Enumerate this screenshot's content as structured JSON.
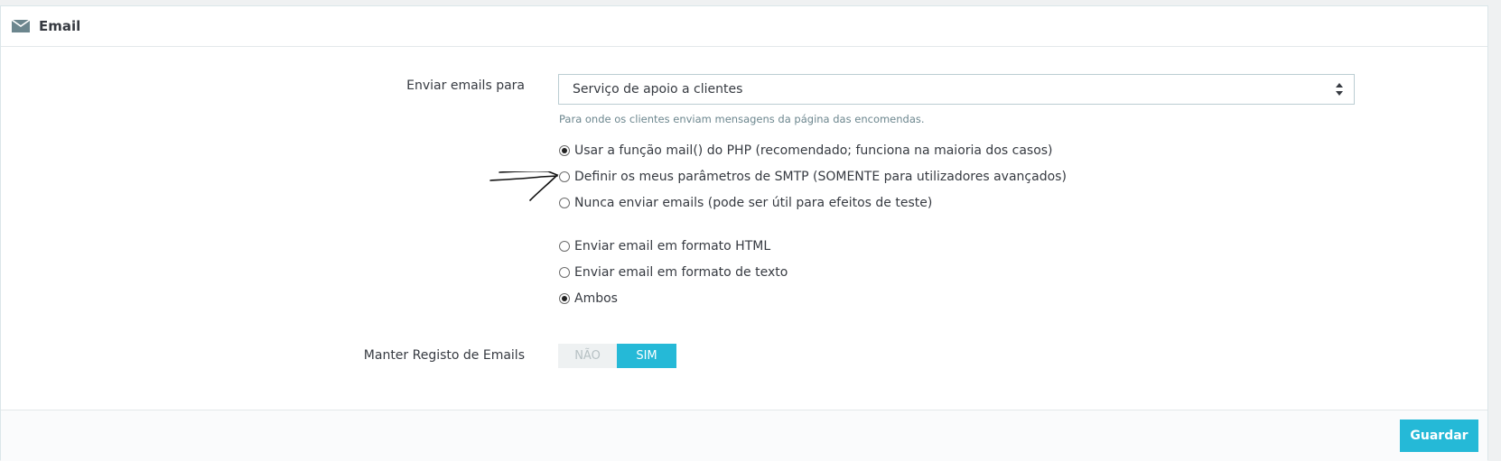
{
  "panel": {
    "title": "Email",
    "icon": "envelope-icon"
  },
  "form": {
    "send_to_label": "Enviar emails para",
    "send_to_value": "Serviço de apoio a clientes",
    "send_to_help": "Para onde os clientes enviam mensagens da página das encomendas.",
    "method_options": [
      {
        "label": "Usar a função mail() do PHP (recomendado; funciona na maioria dos casos)",
        "checked": true
      },
      {
        "label": "Definir os meus parâmetros de SMTP (SOMENTE para utilizadores avançados)",
        "checked": false
      },
      {
        "label": "Nunca enviar emails (pode ser útil para efeitos de teste)",
        "checked": false
      }
    ],
    "format_options": [
      {
        "label": "Enviar email em formato HTML",
        "checked": false
      },
      {
        "label": "Enviar email em formato de texto",
        "checked": false
      },
      {
        "label": "Ambos",
        "checked": true
      }
    ],
    "log_label": "Manter Registo de Emails",
    "log_off": "NÃO",
    "log_on": "SIM",
    "log_value": "SIM"
  },
  "footer": {
    "save_label": "Guardar"
  },
  "colors": {
    "accent": "#25b9d7",
    "text": "#363a41",
    "help": "#6c868e"
  }
}
